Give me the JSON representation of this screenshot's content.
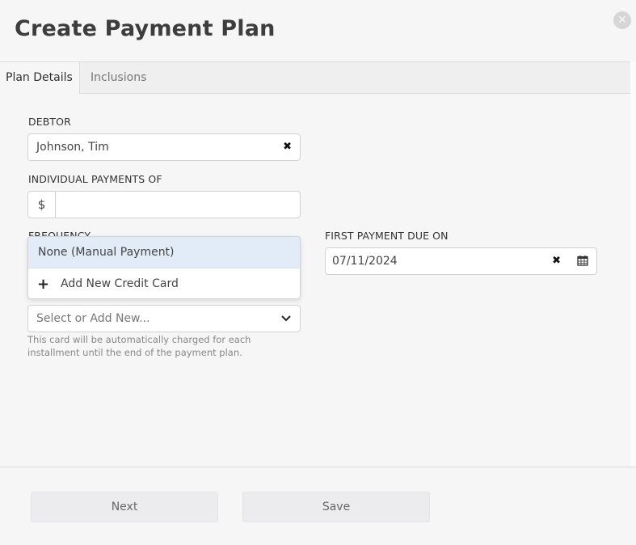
{
  "dialog": {
    "title": "Create Payment Plan"
  },
  "tabs": [
    {
      "label": "Plan Details",
      "active": true
    },
    {
      "label": "Inclusions",
      "active": false
    }
  ],
  "debtor": {
    "label": "DEBTOR",
    "value": "Johnson, Tim"
  },
  "payments": {
    "label": "INDIVIDUAL PAYMENTS OF",
    "prefix": "$",
    "value": ""
  },
  "frequency": {
    "label": "FREQUENCY"
  },
  "dropdown": {
    "options": [
      "None (Manual Payment)",
      "Add New Credit Card"
    ]
  },
  "card": {
    "placeholder": "Select or Add New...",
    "help": "This card will be automatically charged for each installment until the end of the payment plan."
  },
  "first_payment": {
    "label": "FIRST PAYMENT DUE ON",
    "value": "07/11/2024"
  },
  "footer": {
    "next_label": "Next",
    "save_label": "Save"
  },
  "colors": {
    "selected_option_bg": "#e2ecf9",
    "button_bg": "#ececee"
  }
}
